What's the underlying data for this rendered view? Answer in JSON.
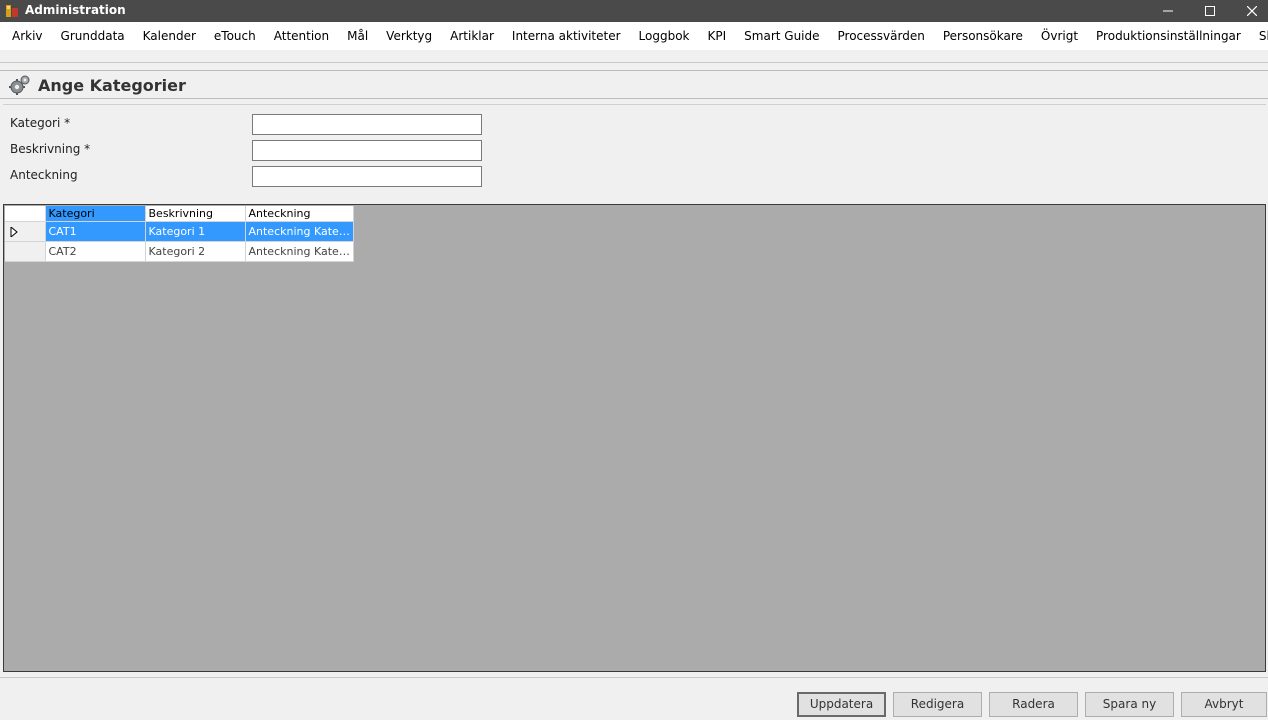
{
  "window": {
    "title": "Administration"
  },
  "menu": [
    "Arkiv",
    "Grunddata",
    "Kalender",
    "eTouch",
    "Attention",
    "Mål",
    "Verktyg",
    "Artiklar",
    "Interna aktiviteter",
    "Loggbok",
    "KPI",
    "Smart Guide",
    "Processvärden",
    "Personsökare",
    "Övrigt",
    "Produktionsinställningar",
    "Skiftöverlämning"
  ],
  "header": {
    "title": "Ange Kategorier",
    "icon": "gears-icon"
  },
  "form": {
    "kategori_label": "Kategori *",
    "beskrivning_label": "Beskrivning *",
    "anteckning_label": "Anteckning",
    "kategori_value": "",
    "beskrivning_value": "",
    "anteckning_value": ""
  },
  "grid": {
    "columns": [
      "Kategori",
      "Beskrivning",
      "Anteckning"
    ],
    "rows": [
      {
        "kategori": "CAT1",
        "beskrivning": "Kategori 1",
        "anteckning": "Anteckning Kate…",
        "selected": true
      },
      {
        "kategori": "CAT2",
        "beskrivning": "Kategori 2",
        "anteckning": "Anteckning Kate…",
        "selected": false
      }
    ]
  },
  "buttons": {
    "uppdatera": "Uppdatera",
    "redigera": "Redigera",
    "radera": "Radera",
    "spara_ny": "Spara ny",
    "avbryt": "Avbryt"
  },
  "colors": {
    "titlebar": "#4a4a4a",
    "selection": "#3399ff",
    "grid_background": "#ababab"
  }
}
